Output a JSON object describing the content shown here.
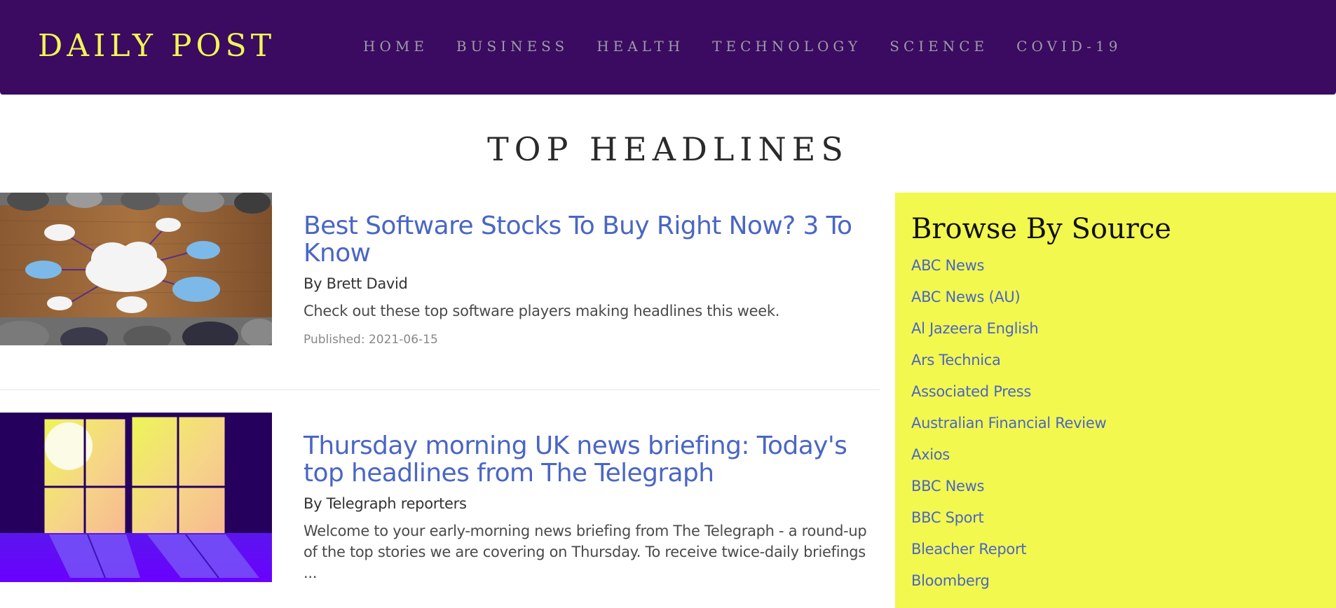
{
  "navbar": {
    "brand": "DAILY POST",
    "links": [
      "HOME",
      "BUSINESS",
      "HEALTH",
      "TECHNOLOGY",
      "SCIENCE",
      "COVID-19"
    ]
  },
  "page_title": "TOP HEADLINES",
  "articles": [
    {
      "title": "Best Software Stocks To Buy Right Now? 3 To Know",
      "author": "By Brett David",
      "description": "Check out these top software players making headlines this week.",
      "published": "Published: 2021-06-15",
      "image": "people-around-table-with-clouds"
    },
    {
      "title": "Thursday morning UK news briefing: Today's top headlines from The Telegraph",
      "author": "By Telegraph reporters",
      "description": "Welcome to your early-morning news briefing from The Telegraph - a round-up of the top stories we are covering on Thursday. To receive twice-daily briefings ...",
      "image": "sunrise-window-illustration"
    }
  ],
  "sidebar": {
    "title": "Browse By Source",
    "sources": [
      "ABC News",
      "ABC News (AU)",
      "Al Jazeera English",
      "Ars Technica",
      "Associated Press",
      "Australian Financial Review",
      "Axios",
      "BBC News",
      "BBC Sport",
      "Bleacher Report",
      "Bloomberg"
    ]
  },
  "colors": {
    "navbar_bg": "#3a0b60",
    "brand": "#f2f555",
    "nav_link": "#9e9ba8",
    "link_blue": "#4a66c4",
    "sidebar_bg": "#f2f84e"
  }
}
